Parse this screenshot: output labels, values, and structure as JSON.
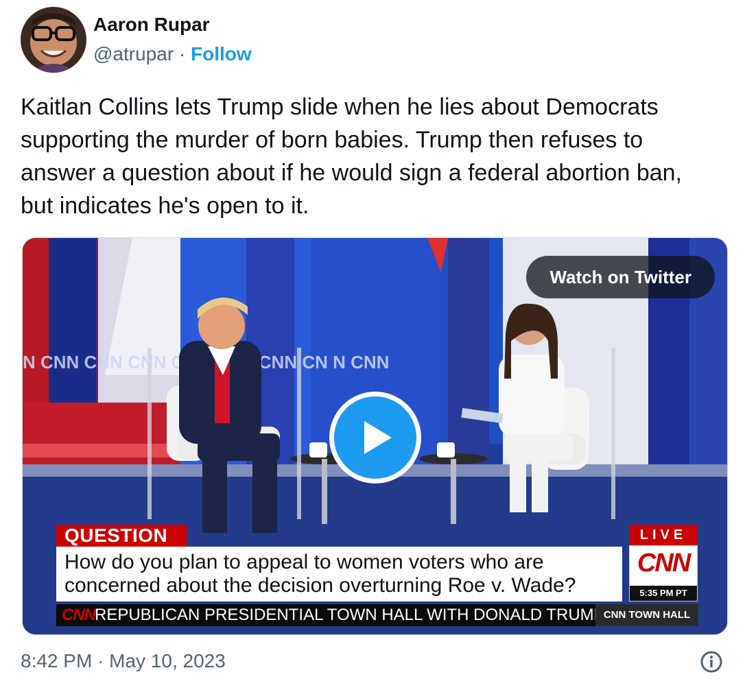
{
  "author": {
    "name": "Aaron Rupar",
    "handle": "@atrupar",
    "separator": "·",
    "follow_label": "Follow"
  },
  "tweet": {
    "text": "Kaitlan Collins lets Trump slide when he lies about Democrats supporting the murder of born babies. Trump then refuses to answer a question about if he would sign a federal abortion ban, but indicates he's open to it."
  },
  "media": {
    "watch_label": "Watch on Twitter",
    "overlay": {
      "question_label": "QUESTION",
      "question_text": "How do you plan to appeal to women voters who are concerned about the decision overturning Roe v. Wade?",
      "live_label": "LIVE",
      "network_logo": "CNN",
      "time": "5:35 PM PT",
      "ticker_logo": "CNN",
      "ticker_text": "REPUBLICAN PRESIDENTIAL TOWN HALL WITH DONALD TRUMP",
      "ticker_right": "CNN TOWN HALL"
    }
  },
  "footer": {
    "timestamp": "8:42 PM · May 10, 2023"
  },
  "icons": {
    "info": "info-icon",
    "play": "play-icon"
  },
  "colors": {
    "follow": "#1d9bf0",
    "play": "#1d9bf0",
    "cnn_red": "#cc0000",
    "muted": "#536471"
  }
}
